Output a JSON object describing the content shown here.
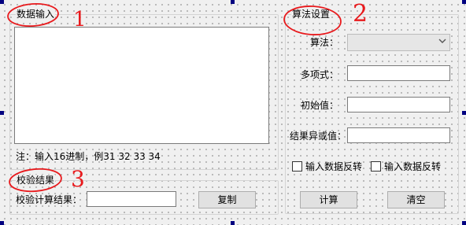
{
  "input_group": {
    "title": "数据输入",
    "hint": "注：输入16进制，例31 32 33 34"
  },
  "algo_group": {
    "title": "算法设置",
    "algorithm_label": "算法：",
    "algorithm_value": "",
    "poly_label": "多项式：",
    "init_label": "初始值：",
    "xor_label": "结果异或值：",
    "check1_label": "输入数据反转",
    "check2_label": "输入数据反转",
    "calc_button": "计算",
    "clear_button": "清空"
  },
  "result_group": {
    "title": "校验结果",
    "result_label": "校验计算结果：",
    "copy_button": "复制"
  },
  "annotations": {
    "one": "1",
    "two": "2",
    "three": "3"
  },
  "icons": {
    "combo": "chevron-down-icon"
  },
  "colors": {
    "annotation": "#e8191c",
    "selection_handle": "#000080"
  }
}
